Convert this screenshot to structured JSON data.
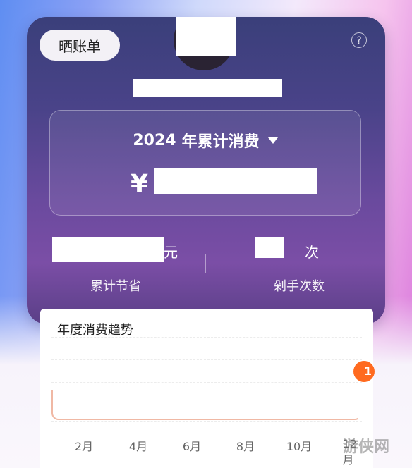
{
  "header": {
    "share_label": "晒账单",
    "help_icon": "question-mark-icon"
  },
  "summary": {
    "year": "2024",
    "title_suffix": "年累计消费",
    "currency_symbol": "¥"
  },
  "stats": {
    "savings_unit": "元",
    "savings_label": "累计节省",
    "purchases_unit": "次",
    "purchases_label": "剁手次数"
  },
  "trend": {
    "title": "年度消费趋势",
    "badge": "1",
    "months": [
      "2月",
      "4月",
      "6月",
      "8月",
      "10月",
      "12月"
    ]
  },
  "watermark": "游侠网",
  "colors": {
    "accent_orange": "#ff6a1f",
    "card_top": "#3a3f7a",
    "card_bottom": "#7b4ea6"
  }
}
